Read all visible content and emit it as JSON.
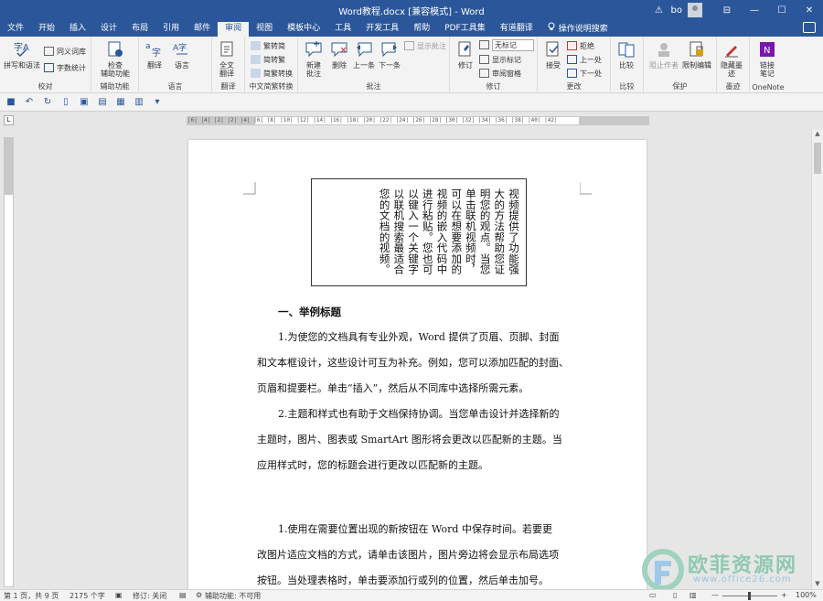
{
  "window": {
    "title": "Word教程.docx [兼容模式] - Word",
    "warning_glyph": "⚠",
    "user": "bo",
    "controls": {
      "ribbon_opts": "⊟",
      "minimize": "—",
      "maximize": "☐",
      "close": "✕"
    }
  },
  "menu": {
    "tabs": [
      "文件",
      "开始",
      "插入",
      "设计",
      "布局",
      "引用",
      "邮件",
      "审阅",
      "视图",
      "模板中心",
      "工具",
      "开发工具",
      "帮助",
      "PDF工具集",
      "有道翻译"
    ],
    "active": "审阅",
    "tell_me": "操作说明搜索"
  },
  "ribbon": {
    "proofing": {
      "label": "校对",
      "spelling": "拼写和语法",
      "thesaurus": "同义词库",
      "wordcount": "字数统计"
    },
    "accessibility": {
      "label": "辅助功能",
      "check": "检查\n辅助功能"
    },
    "language": {
      "label": "语言",
      "translate": "翻译",
      "language": "语言"
    },
    "translate_grp": {
      "label": "翻译",
      "full": "全文\n翻译"
    },
    "chinese_conv": {
      "label": "中文简繁转换",
      "to_simple": "繁转简",
      "to_trad": "简转繁",
      "conv": "简繁转换"
    },
    "comments": {
      "label": "批注",
      "new": "新建\n批注",
      "delete": "删除",
      "prev": "上一条",
      "next": "下一条",
      "show": "显示批注"
    },
    "tracking": {
      "label": "修订",
      "track": "修订",
      "markup_value": "无标记",
      "show_markup": "显示标记",
      "pane": "审阅窗格"
    },
    "changes": {
      "label": "更改",
      "accept": "接受",
      "reject": "拒绝",
      "prev": "上一处",
      "next": "下一处"
    },
    "compare": {
      "label": "比较",
      "compare": "比较"
    },
    "protect": {
      "label": "保护",
      "block": "阻止作者",
      "restrict": "限制编辑"
    },
    "ink": {
      "label": "墨迹",
      "hide": "隐藏墨\n迹"
    },
    "onenote": {
      "label": "OneNote",
      "link": "链接\n笔记"
    }
  },
  "ruler": {
    "corner": "L",
    "text": "│6│ │4│ │2│ │2│ │4│ │6│ │8│ │10│ │12│ │14│ │16│ │18│ │20│ │22│ │24│ │26│ │28│ │30│ │32│ │34│ │36│ │38│ │40│ │42│"
  },
  "document": {
    "textbox_vertical": "视频提供了功能强大的方法帮助您证明您的观点。当您单击联机视频时，可以在想要添加的视频的嵌入代码中进行粘贴。您也可以键入一个关键字以联机搜索最适合您的文档的视频。",
    "heading": "一、举例标题",
    "lines": [
      "1.为使您的文档具有专业外观，Word 提供了页眉、页脚、封面",
      "和文本框设计，这些设计可互为补充。例如，您可以添加匹配的封面、",
      "页眉和提要栏。单击“插入”，然后从不同库中选择所需元素。",
      "2.主题和样式也有助于文档保持协调。当您单击设计并选择新的",
      "主题时，图片、图表或 SmartArt 图形将会更改以匹配新的主题。当",
      "应用样式时，您的标题会进行更改以匹配新的主题。"
    ],
    "lines2": [
      "1.使用在需要位置出现的新按钮在 Word 中保存时间。若要更",
      "改图片适应文档的方式，请单击该图片，图片旁边将会显示布局选项",
      "按钮。当处理表格时，单击要添加行或列的位置，然后单击加号。"
    ]
  },
  "statusbar": {
    "page": "第 1 页，共 9 页",
    "words": "2175 个字",
    "track": "修订: 关闭",
    "accessibility": "辅助功能: 不可用",
    "zoom": "100%",
    "zoom_minus": "—",
    "zoom_plus": "+"
  },
  "watermark": {
    "text": "欧菲资源网",
    "url": "www.office26.com"
  }
}
